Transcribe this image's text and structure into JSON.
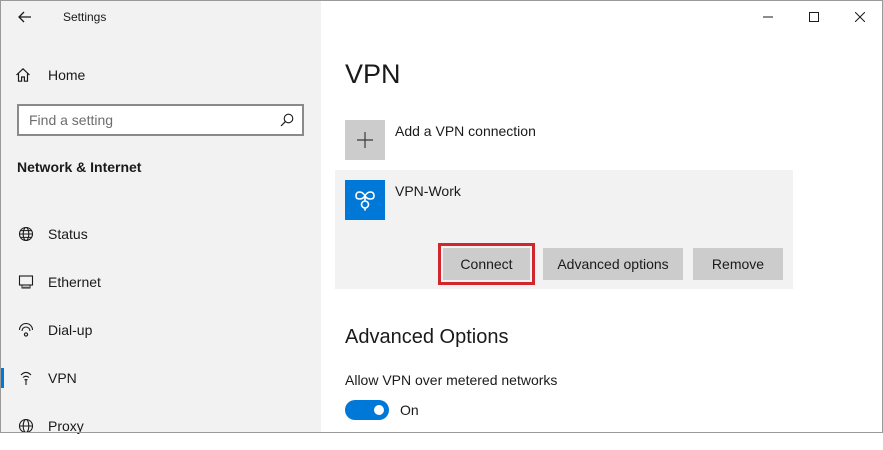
{
  "window": {
    "title": "Settings",
    "controls": [
      "minimize",
      "maximize",
      "close"
    ]
  },
  "sidebar": {
    "home_label": "Home",
    "search": {
      "placeholder": "Find a setting",
      "value": ""
    },
    "section_heading": "Network & Internet",
    "items": [
      {
        "label": "Status",
        "icon": "globe-icon",
        "selected": false
      },
      {
        "label": "Ethernet",
        "icon": "ethernet-icon",
        "selected": false
      },
      {
        "label": "Dial-up",
        "icon": "dial-up-icon",
        "selected": false
      },
      {
        "label": "VPN",
        "icon": "vpn-icon",
        "selected": true
      },
      {
        "label": "Proxy",
        "icon": "proxy-globe-icon",
        "selected": false
      }
    ]
  },
  "main": {
    "title": "VPN",
    "add_connection_label": "Add a VPN connection",
    "connection": {
      "name": "VPN-Work",
      "buttons": {
        "connect": "Connect",
        "advanced": "Advanced options",
        "remove": "Remove"
      }
    },
    "advanced_options": {
      "heading": "Advanced Options",
      "metered_label": "Allow VPN over metered networks",
      "metered_state": "On",
      "metered_enabled": true
    }
  },
  "colors": {
    "accent": "#0078d7",
    "highlight": "#d1262e",
    "sidebar_bg": "#f2f2f2",
    "button_bg": "#cccccc"
  }
}
